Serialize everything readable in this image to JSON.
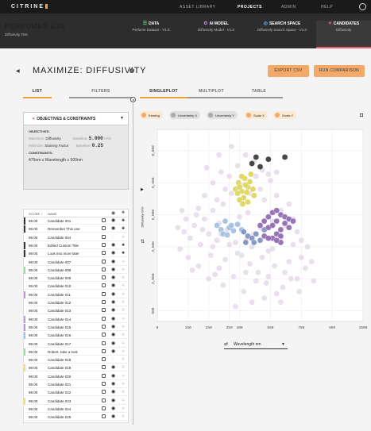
{
  "brand": {
    "name": "CITRINE",
    "sub": "INFORMATICS"
  },
  "topnav": {
    "asset_library": "ASSET LIBRARY",
    "projects": "PROJECTS",
    "admin": "ADMIN",
    "help": "HELP"
  },
  "project": {
    "title": "PERFUMES E2E",
    "subtitle": "Diffusivity Test"
  },
  "stages": [
    {
      "title": "DATA",
      "sub": "Perfume Dataset - V1.0"
    },
    {
      "title": "AI MODEL",
      "sub": "Diffusivity Model - V1.0"
    },
    {
      "title": "SEARCH SPACE",
      "sub": "Diffusivity Search Space - V1.0"
    },
    {
      "title": "CANDIDATES",
      "sub": "Diffusivity"
    }
  ],
  "page": {
    "title": "MAXIMIZE: DIFFUSIVITY",
    "export_btn": "EXPORT CSV",
    "run_btn": "RUN COMPARISON"
  },
  "left_tabs": {
    "list": "LIST",
    "filters": "FILTERS"
  },
  "right_tabs": {
    "single": "SINGLEPLOT",
    "multi": "MULTIPLOT",
    "table": "TABLE"
  },
  "objectives": {
    "header": "OBJECTIVES & CONSTRAINTS",
    "objectives_label": "OBJECTIVES:",
    "obj1_kind": "Maximize:",
    "obj1_name": "Diffusivity",
    "obj1_base_label": "Baseline:",
    "obj1_base": "5.000",
    "obj1_unit": "m²/s",
    "obj2_kind": "Minimize:",
    "obj2_name": "Staining Factor",
    "obj2_base_label": "Baseline:",
    "obj2_base": "0.25",
    "constraints_label": "CONSTRAINTS:",
    "constraint": "475nm ≤ Wavelength ≤ 500nm"
  },
  "table": {
    "col_score": "SCORE ↑",
    "col_name": "NAME",
    "rows": [
      {
        "score": "99.00",
        "name": "Candidate 001",
        "color": "#333333",
        "pinned": true
      },
      {
        "score": "99.00",
        "name": "Remember This one",
        "color": "#333333",
        "pinned": true
      },
      {
        "score": "99.00",
        "name": "Candidate 004",
        "color": "#ffffff",
        "pinned": false,
        "hidden": true
      },
      {
        "score": "99.00",
        "name": "Edited Custom Title",
        "color": "#333333",
        "pinned": true
      },
      {
        "score": "99.00",
        "name": "Look into more later",
        "color": "#333333",
        "pinned": true
      },
      {
        "score": "99.00",
        "name": "Candidate 007",
        "color": "#ffffff",
        "pinned": false
      },
      {
        "score": "99.00",
        "name": "Candidate 008",
        "color": "#9bd8a4",
        "pinned": false
      },
      {
        "score": "99.00",
        "name": "Candidate 009",
        "color": "#ffffff",
        "pinned": false
      },
      {
        "score": "99.00",
        "name": "Candidate 010",
        "color": "#ffffff",
        "pinned": false
      },
      {
        "score": "99.00",
        "name": "Candidate 011",
        "color": "#b89ccf",
        "pinned": false
      },
      {
        "score": "99.00",
        "name": "Candidate 012",
        "color": "#ffffff",
        "pinned": false
      },
      {
        "score": "99.00",
        "name": "Candidate 013",
        "color": "#ffffff",
        "pinned": false
      },
      {
        "score": "99.00",
        "name": "Candidate 014",
        "color": "#b89ccf",
        "pinned": false
      },
      {
        "score": "99.00",
        "name": "Candidate 015",
        "color": "#b89ccf",
        "pinned": false
      },
      {
        "score": "99.00",
        "name": "Candidate 016",
        "color": "#9ec3e6",
        "pinned": false
      },
      {
        "score": "99.00",
        "name": "Candidate 017",
        "color": "#ffffff",
        "pinned": false
      },
      {
        "score": "99.00",
        "name": "Robert, take a look",
        "color": "#9bd8a4",
        "pinned": false
      },
      {
        "score": "99.00",
        "name": "Candidate 018",
        "color": "#ffffff",
        "pinned": false,
        "hidden": true
      },
      {
        "score": "99.00",
        "name": "Candidate 019",
        "color": "#e8e07a",
        "pinned": false
      },
      {
        "score": "99.00",
        "name": "Candidate 020",
        "color": "#ffffff",
        "pinned": false
      },
      {
        "score": "99.00",
        "name": "Candidate 021",
        "color": "#ffffff",
        "pinned": false
      },
      {
        "score": "99.00",
        "name": "Candidate 022",
        "color": "#ffffff",
        "pinned": false
      },
      {
        "score": "99.00",
        "name": "Candidate 023",
        "color": "#e8e07a",
        "pinned": false
      },
      {
        "score": "99.00",
        "name": "Candidate 024",
        "color": "#ffffff",
        "pinned": false
      },
      {
        "score": "99.00",
        "name": "Candidate 025",
        "color": "#ffffff",
        "pinned": false
      }
    ]
  },
  "filters": [
    {
      "label": "Existing",
      "on": true
    },
    {
      "label": "Uncertainty X",
      "on": false
    },
    {
      "label": "Uncertainty Y",
      "on": false
    },
    {
      "label": "Scale X",
      "on": true
    },
    {
      "label": "Goals Y",
      "on": true
    }
  ],
  "x_selector": "Wavelength nm",
  "colors": {
    "accent": "#f2a96a",
    "candidate_stage": "#e85d75"
  },
  "chart_data": {
    "type": "scatter",
    "xlabel": "",
    "ylabel": "Diffusivity m²/s",
    "xlim": [
      0,
      1000
    ],
    "ylim": [
      0,
      9000
    ],
    "x_ticks": [
      0,
      150,
      250,
      350,
      400,
      550,
      700,
      850,
      1000
    ],
    "y_ticks": [
      500,
      2000,
      3500,
      5000,
      6500,
      8000
    ],
    "grid": true,
    "series": [
      {
        "name": "",
        "color": "#e3d4e6",
        "description": "existing",
        "points": [
          [
            130,
            4200
          ],
          [
            160,
            3900
          ],
          [
            180,
            4500
          ],
          [
            210,
            3600
          ],
          [
            230,
            4800
          ],
          [
            250,
            4100
          ],
          [
            270,
            5200
          ],
          [
            290,
            3800
          ],
          [
            300,
            4600
          ],
          [
            320,
            5500
          ],
          [
            340,
            4300
          ],
          [
            360,
            6000
          ],
          [
            380,
            3700
          ],
          [
            400,
            4900
          ],
          [
            420,
            6400
          ],
          [
            440,
            5100
          ],
          [
            460,
            3500
          ],
          [
            480,
            6800
          ],
          [
            500,
            4400
          ],
          [
            520,
            5700
          ],
          [
            540,
            3300
          ],
          [
            560,
            4700
          ],
          [
            580,
            5900
          ],
          [
            600,
            3900
          ],
          [
            620,
            4500
          ],
          [
            640,
            2800
          ],
          [
            660,
            3600
          ],
          [
            680,
            4200
          ],
          [
            700,
            3000
          ],
          [
            720,
            2500
          ],
          [
            150,
            3000
          ],
          [
            200,
            2600
          ],
          [
            260,
            3100
          ],
          [
            280,
            2200
          ],
          [
            330,
            2900
          ],
          [
            370,
            2100
          ],
          [
            410,
            3100
          ],
          [
            450,
            2700
          ],
          [
            490,
            2300
          ],
          [
            530,
            1800
          ],
          [
            570,
            2600
          ],
          [
            610,
            1600
          ],
          [
            650,
            2000
          ],
          [
            690,
            1400
          ],
          [
            230,
            5900
          ],
          [
            270,
            6500
          ],
          [
            310,
            7000
          ],
          [
            350,
            6800
          ],
          [
            390,
            7300
          ],
          [
            430,
            7800
          ],
          [
            470,
            7500
          ],
          [
            510,
            7100
          ],
          [
            550,
            6600
          ],
          [
            200,
            5300
          ],
          [
            240,
            7200
          ],
          [
            300,
            7800
          ],
          [
            360,
            8200
          ],
          [
            120,
            5200
          ],
          [
            100,
            4400
          ],
          [
            110,
            3400
          ],
          [
            170,
            2400
          ],
          [
            320,
            1700
          ],
          [
            420,
            1400
          ],
          [
            460,
            900
          ],
          [
            520,
            1100
          ],
          [
            580,
            1300
          ],
          [
            620,
            2300
          ],
          [
            680,
            2000
          ],
          [
            730,
            3500
          ],
          [
            750,
            2800
          ],
          [
            760,
            1900
          ],
          [
            600,
            5200
          ],
          [
            640,
            5500
          ],
          [
            660,
            4800
          ],
          [
            700,
            3800
          ],
          [
            560,
            3400
          ],
          [
            510,
            3000
          ],
          [
            470,
            4100
          ],
          [
            430,
            3800
          ],
          [
            390,
            3200
          ],
          [
            350,
            3600
          ],
          [
            310,
            4100
          ],
          [
            270,
            3500
          ],
          [
            220,
            4300
          ],
          [
            190,
            5000
          ],
          [
            140,
            4800
          ],
          [
            250,
            2000
          ],
          [
            300,
            2500
          ],
          [
            430,
            2300
          ],
          [
            480,
            1900
          ],
          [
            540,
            2100
          ],
          [
            600,
            900
          ],
          [
            380,
            700
          ],
          [
            330,
            6200
          ],
          [
            290,
            5700
          ],
          [
            410,
            5600
          ],
          [
            450,
            6000
          ],
          [
            500,
            6200
          ],
          [
            540,
            6900
          ],
          [
            580,
            7000
          ]
        ]
      },
      {
        "name": "",
        "color": "#ddd557",
        "description": "yellow",
        "points": [
          [
            380,
            6200
          ],
          [
            395,
            6500
          ],
          [
            410,
            6100
          ],
          [
            425,
            6700
          ],
          [
            440,
            6300
          ],
          [
            455,
            6900
          ],
          [
            420,
            5800
          ],
          [
            400,
            5700
          ],
          [
            440,
            5600
          ],
          [
            465,
            6200
          ],
          [
            390,
            6000
          ],
          [
            430,
            6400
          ],
          [
            410,
            6800
          ],
          [
            450,
            6550
          ],
          [
            470,
            5900
          ],
          [
            415,
            5500
          ],
          [
            435,
            6050
          ],
          [
            400,
            6300
          ]
        ]
      },
      {
        "name": "",
        "color": "#333333",
        "description": "dark",
        "points": [
          [
            460,
            7400
          ],
          [
            480,
            7700
          ],
          [
            500,
            7250
          ],
          [
            540,
            7600
          ],
          [
            620,
            7700
          ]
        ]
      },
      {
        "name": "",
        "color": "#9fbfe0",
        "description": "blue",
        "points": [
          [
            290,
            4500
          ],
          [
            310,
            4300
          ],
          [
            330,
            4700
          ],
          [
            350,
            4400
          ],
          [
            370,
            4250
          ],
          [
            390,
            4550
          ],
          [
            410,
            4300
          ],
          [
            320,
            4100
          ],
          [
            340,
            4050
          ],
          [
            360,
            4500
          ]
        ]
      },
      {
        "name": "",
        "color": "#7d8fc0",
        "description": "slate",
        "points": [
          [
            420,
            4200
          ],
          [
            440,
            4000
          ],
          [
            460,
            3900
          ],
          [
            480,
            4100
          ],
          [
            500,
            3800
          ],
          [
            520,
            4300
          ],
          [
            430,
            3700
          ],
          [
            470,
            3700
          ]
        ]
      },
      {
        "name": "",
        "color": "#8e66b0",
        "description": "purple",
        "points": [
          [
            520,
            4700
          ],
          [
            540,
            4900
          ],
          [
            560,
            5100
          ],
          [
            580,
            5200
          ],
          [
            600,
            5000
          ],
          [
            620,
            4600
          ],
          [
            540,
            4400
          ],
          [
            560,
            4500
          ],
          [
            580,
            4700
          ],
          [
            600,
            4300
          ],
          [
            620,
            4900
          ],
          [
            640,
            4800
          ],
          [
            560,
            3900
          ],
          [
            580,
            4100
          ],
          [
            600,
            4000
          ],
          [
            520,
            4000
          ],
          [
            540,
            3900
          ],
          [
            600,
            3700
          ],
          [
            640,
            4400
          ],
          [
            660,
            4700
          ],
          [
            500,
            4500
          ],
          [
            580,
            3800
          ]
        ]
      }
    ]
  }
}
